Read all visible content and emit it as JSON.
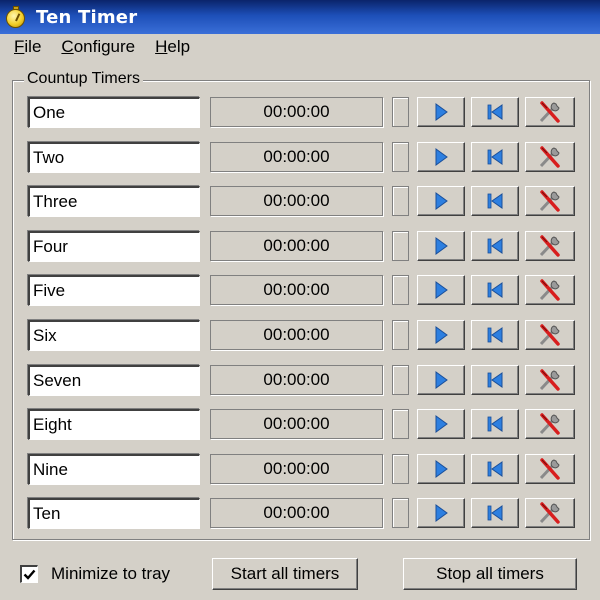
{
  "window": {
    "title": "Ten Timer"
  },
  "menu": {
    "items": [
      {
        "label": "File",
        "underline": "F",
        "rest": "ile"
      },
      {
        "label": "Configure",
        "underline": "C",
        "rest": "onfigure"
      },
      {
        "label": "Help",
        "underline": "H",
        "rest": "elp"
      }
    ]
  },
  "group": {
    "label": "Countup Timers"
  },
  "timers": [
    {
      "name": "One",
      "time": "00:00:00"
    },
    {
      "name": "Two",
      "time": "00:00:00"
    },
    {
      "name": "Three",
      "time": "00:00:00"
    },
    {
      "name": "Four",
      "time": "00:00:00"
    },
    {
      "name": "Five",
      "time": "00:00:00"
    },
    {
      "name": "Six",
      "time": "00:00:00"
    },
    {
      "name": "Seven",
      "time": "00:00:00"
    },
    {
      "name": "Eight",
      "time": "00:00:00"
    },
    {
      "name": "Nine",
      "time": "00:00:00"
    },
    {
      "name": "Ten",
      "time": "00:00:00"
    }
  ],
  "bottom": {
    "minimize_label": "Minimize to tray",
    "minimize_checked": true,
    "start_all_label": "Start all timers",
    "stop_all_label": "Stop all timers"
  },
  "icons": {
    "app": "stopwatch-icon",
    "play": "play-icon",
    "reset": "reset-icon",
    "config": "tools-icon",
    "check": "checkmark-icon"
  },
  "colors": {
    "window_bg": "#d4d0c8",
    "titlebar": "#0a246a",
    "play_blue": "#2d7fe0",
    "tools_red": "#d81e1e"
  }
}
